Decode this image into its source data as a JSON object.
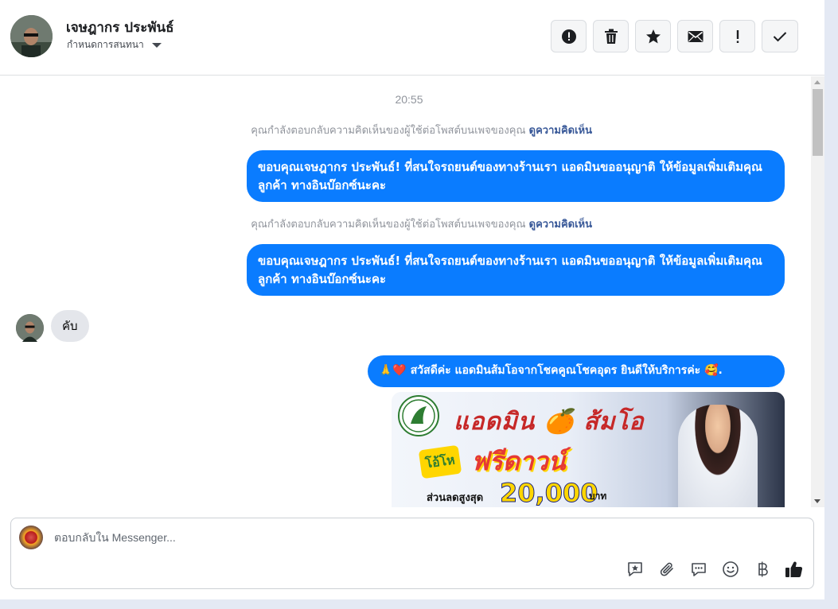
{
  "header": {
    "contact_name": "เจษฎากร ประพันธ์",
    "assign_label": "กำหนดการสนทนา",
    "actions": [
      {
        "name": "mark-spam-button",
        "icon": "alert-circle-icon"
      },
      {
        "name": "delete-button",
        "icon": "trash-icon"
      },
      {
        "name": "star-button",
        "icon": "star-icon"
      },
      {
        "name": "mark-unread-button",
        "icon": "envelope-icon"
      },
      {
        "name": "follow-up-button",
        "icon": "exclamation-icon"
      },
      {
        "name": "mark-done-button",
        "icon": "checkmark-icon"
      }
    ]
  },
  "conversation": {
    "timestamp": "20:55",
    "reply_note": {
      "text": "คุณกำลังตอบกลับความคิดเห็นของผู้ใช้ต่อโพสต์บนเพจของคุณ",
      "link": "ดูความคิดเห็น"
    },
    "outgoing_1": "ขอบคุณเจษฎากร ประพันธ์! ที่สนใจรถยนต์ของทางร้านเรา แอดมินขออนุญาติ ให้ข้อมูลเพิ่มเติมคุณลูกค้า ทางอินบ๊อกซ์นะคะ",
    "outgoing_2": "ขอบคุณเจษฎากร ประพันธ์! ที่สนใจรถยนต์ของทางร้านเรา แอดมินขออนุญาติ ให้ข้อมูลเพิ่มเติมคุณลูกค้า ทางอินบ๊อกซ์นะคะ",
    "incoming_1": "คับ",
    "outgoing_3": "🙏❤️ สวัสดีค่ะ แอดมินส้มโอจากโชคคูณโชคอุดร ยินดีให้บริการค่ะ 🥰.",
    "promo_image": {
      "title": "แอดมิน 🍊 ส้มโอ",
      "burst": "โอ้โห",
      "headline": "ฟรีดาวน์",
      "discount_label": "ส่วนลดสูงสุด",
      "amount": "20,000",
      "unit": "บาท"
    }
  },
  "composer": {
    "placeholder": "ตอบกลับใน Messenger...",
    "tools": [
      "saved-reply-icon",
      "attachment-icon",
      "quick-reply-icon",
      "emoji-icon",
      "baht-icon",
      "thumbs-up-icon"
    ]
  },
  "colors": {
    "outgoing_bubble": "#0a7cff",
    "incoming_bubble": "#e4e6eb",
    "link": "#385898"
  }
}
